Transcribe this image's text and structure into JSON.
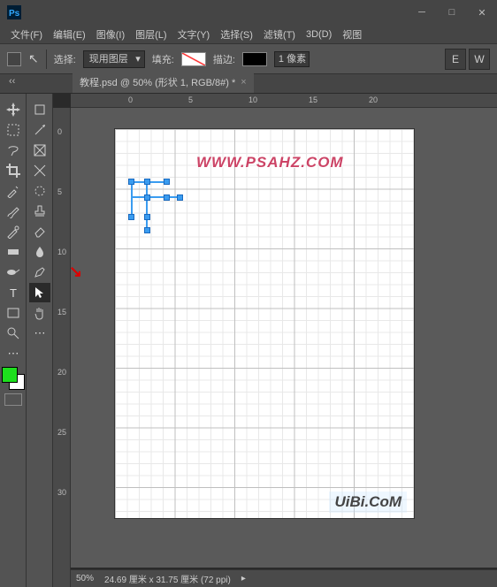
{
  "window": {
    "app_logo": "Ps"
  },
  "menu": [
    "文件(F)",
    "编辑(E)",
    "图像(I)",
    "图层(L)",
    "文字(Y)",
    "选择(S)",
    "滤镜(T)",
    "3D(D)",
    "视图"
  ],
  "options": {
    "select_label": "选择:",
    "select_value": "现用图层",
    "fill_label": "填充:",
    "stroke_label": "描边:",
    "stroke_width": "1 像素",
    "right_buttons": [
      "E",
      "W"
    ]
  },
  "tab": {
    "title": "教程.psd @ 50% (形状 1, RGB/8#) *"
  },
  "rulers": {
    "h": [
      "0",
      "5",
      "10",
      "15",
      "20"
    ],
    "v": [
      "0",
      "5",
      "10",
      "15",
      "20",
      "25",
      "30"
    ]
  },
  "watermarks": {
    "top": "WWW.PSAHZ.COM",
    "bottom": "UiBi.CoM"
  },
  "status": {
    "zoom": "50%",
    "dims": "24.69 厘米 x 31.75 厘米 (72 ppi)"
  }
}
